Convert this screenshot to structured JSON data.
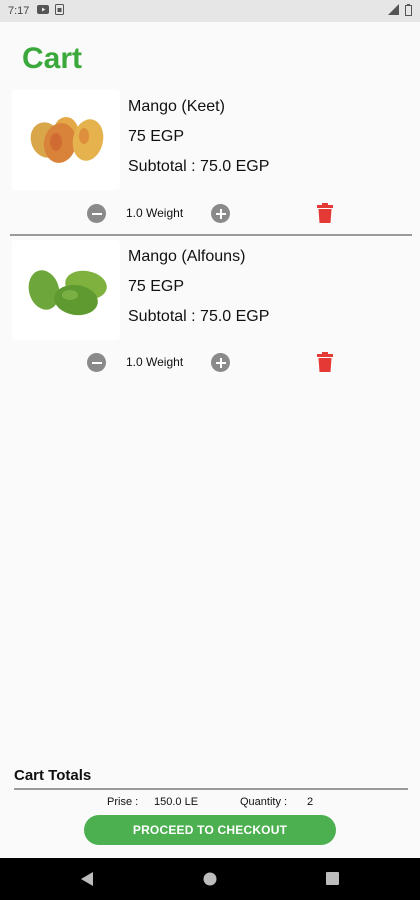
{
  "status_bar": {
    "time": "7:17"
  },
  "page": {
    "title": "Cart"
  },
  "cart_items": [
    {
      "name": "Mango (Keet)",
      "price": "75 EGP",
      "subtotal": "Subtotal : 75.0 EGP",
      "quantity": "1.0 Weight",
      "image": "mango-keet-image"
    },
    {
      "name": "Mango (Alfouns)",
      "price": "75 EGP",
      "subtotal": "Subtotal : 75.0 EGP",
      "quantity": "1.0 Weight",
      "image": "mango-alfouns-image"
    }
  ],
  "totals": {
    "title": "Cart Totals",
    "price_label": "Prise :",
    "price_value": "150.0 LE",
    "quantity_label": "Quantity :",
    "quantity_value": "2"
  },
  "checkout": {
    "label": "PROCEED TO CHECKOUT"
  },
  "colors": {
    "accent": "#3aa83a",
    "button": "#4caf50",
    "delete": "#e53935"
  }
}
